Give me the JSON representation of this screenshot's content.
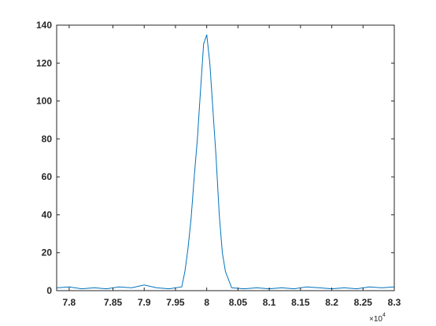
{
  "chart_data": {
    "type": "line",
    "title": "",
    "xlabel": "",
    "ylabel": "",
    "xlim": [
      77600,
      83000
    ],
    "ylim": [
      0,
      140
    ],
    "x_exponent_label": {
      "base": "×10",
      "power": "4"
    },
    "x_ticks": [
      77800,
      78500,
      79000,
      79500,
      80000,
      80500,
      81000,
      81500,
      82000,
      82500,
      83000
    ],
    "x_tick_labels": [
      "7.8",
      "7.85",
      "7.9",
      "7.95",
      "8",
      "8.05",
      "8.1",
      "8.15",
      "8.2",
      "8.25",
      "8.3"
    ],
    "y_ticks": [
      0,
      20,
      40,
      60,
      80,
      100,
      120,
      140
    ],
    "y_tick_labels": [
      "0",
      "20",
      "40",
      "60",
      "80",
      "100",
      "120",
      "140"
    ],
    "grid": false,
    "box": true,
    "line_color": "#0072bd",
    "series": [
      {
        "x": [
          77600,
          77800,
          78000,
          78200,
          78400,
          78600,
          78800,
          79000,
          79200,
          79400,
          79600,
          79650,
          79700,
          79750,
          79800,
          79850,
          79900,
          79950,
          80000,
          80050,
          80100,
          80150,
          80200,
          80250,
          80300,
          80400,
          80600,
          80800,
          81000,
          81200,
          81400,
          81600,
          81800,
          82000,
          82200,
          82400,
          82600,
          82800,
          83000
        ],
        "y": [
          1.5,
          2,
          1,
          1.5,
          1,
          2,
          1.5,
          3,
          1.5,
          1,
          2,
          10,
          22,
          38,
          60,
          80,
          105,
          130,
          135,
          120,
          95,
          70,
          40,
          20,
          10,
          1.5,
          1,
          1.5,
          1,
          1.5,
          1,
          2,
          1.5,
          1,
          1.5,
          1,
          2,
          1.5,
          2
        ]
      }
    ]
  }
}
